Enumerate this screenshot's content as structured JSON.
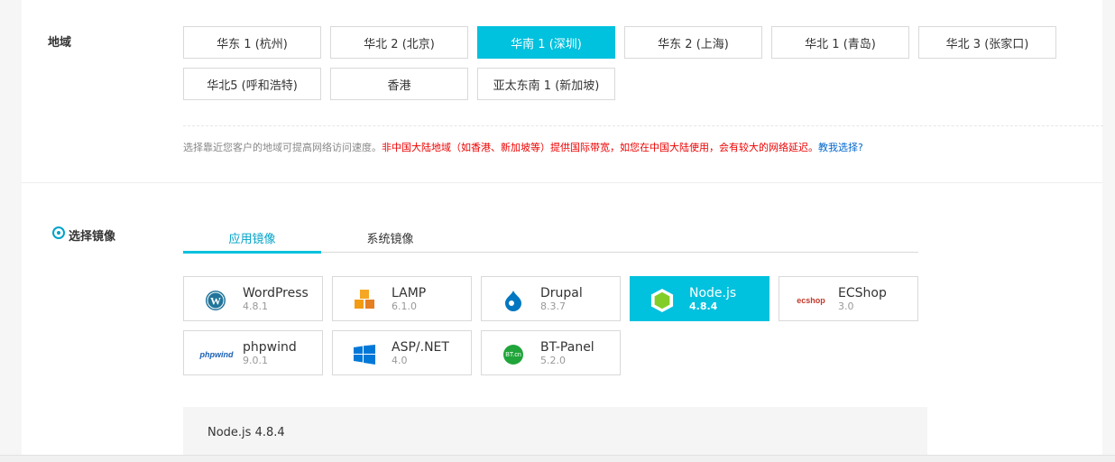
{
  "region": {
    "label": "地域",
    "options": [
      "华东 1 (杭州)",
      "华北 2 (北京)",
      "华南 1 (深圳)",
      "华东 2 (上海)",
      "华北 1 (青岛)",
      "华北 3 (张家口)",
      "华北5 (呼和浩特)",
      "香港",
      "亚太东南 1 (新加坡)"
    ],
    "selected": "华南 1 (深圳)",
    "hint_normal": "选择靠近您客户的地域可提高网络访问速度。",
    "hint_warning": "非中国大陆地域（如香港、新加坡等）提供国际带宽，如您在中国大陆使用，会有较大的网络延迟。",
    "hint_link": "教我选择?"
  },
  "image": {
    "label": "选择镜像",
    "tabs": [
      "应用镜像",
      "系统镜像"
    ],
    "active_tab": "应用镜像",
    "items": [
      {
        "name": "WordPress",
        "version": "4.8.1",
        "icon": "wordpress-icon"
      },
      {
        "name": "LAMP",
        "version": "6.1.0",
        "icon": "lamp-icon"
      },
      {
        "name": "Drupal",
        "version": "8.3.7",
        "icon": "drupal-icon"
      },
      {
        "name": "Node.js",
        "version": "4.8.4",
        "icon": "nodejs-icon"
      },
      {
        "name": "ECShop",
        "version": "3.0",
        "icon": "ecshop-icon",
        "logo_text": "ecshop"
      },
      {
        "name": "phpwind",
        "version": "9.0.1",
        "icon": "phpwind-icon",
        "logo_text": "phpwind"
      },
      {
        "name": "ASP/.NET",
        "version": "4.0",
        "icon": "windows-icon"
      },
      {
        "name": "BT-Panel",
        "version": "5.2.0",
        "icon": "btpanel-icon",
        "logo_text": "BT.cn"
      }
    ],
    "selected": "Node.js",
    "selected_info": "Node.js 4.8.4"
  },
  "colors": {
    "accent": "#00c1de",
    "warning": "#ee0000",
    "link": "#0066cc"
  }
}
